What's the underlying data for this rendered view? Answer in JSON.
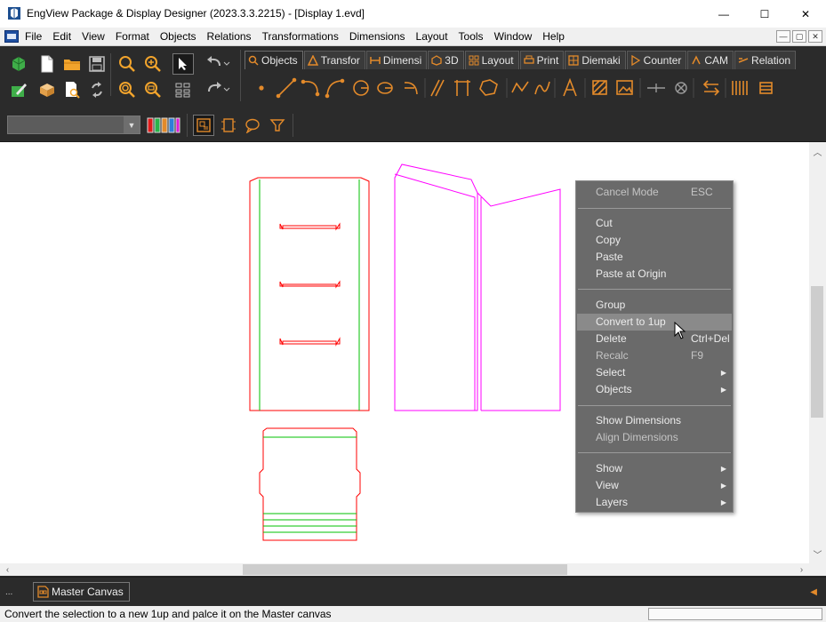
{
  "window": {
    "title": "EngView Package & Display Designer (2023.3.3.2215) - [Display 1.evd]",
    "minimize": "—",
    "maximize": "☐",
    "close": "✕"
  },
  "menu": {
    "items": [
      "File",
      "Edit",
      "View",
      "Format",
      "Objects",
      "Relations",
      "Transformations",
      "Dimensions",
      "Layout",
      "Tools",
      "Window",
      "Help"
    ],
    "mdi_minimize": "—",
    "mdi_restore": "▢",
    "mdi_close": "✕"
  },
  "toolbar": {
    "tabs": [
      {
        "label": "Objects",
        "active": true
      },
      {
        "label": "Transfor",
        "active": false
      },
      {
        "label": "Dimensi",
        "active": false
      },
      {
        "label": "3D",
        "active": false
      },
      {
        "label": "Layout",
        "active": false
      },
      {
        "label": "Print",
        "active": false
      },
      {
        "label": "Diemaki",
        "active": false
      },
      {
        "label": "Counter",
        "active": false
      },
      {
        "label": "CAM",
        "active": false
      },
      {
        "label": "Relation",
        "active": false
      }
    ],
    "layer_combo_value": ""
  },
  "context_menu": {
    "items": [
      {
        "label": "Cancel Mode",
        "shortcut": "ESC",
        "disabled": false
      },
      {
        "label": "Cut",
        "disabled": false
      },
      {
        "label": "Copy",
        "disabled": false
      },
      {
        "label": "Paste",
        "disabled": false
      },
      {
        "label": "Paste at Origin",
        "disabled": false
      },
      {
        "label": "Group",
        "disabled": false
      },
      {
        "label": "Convert to 1up",
        "disabled": false,
        "hover": true
      },
      {
        "label": "Delete",
        "shortcut": "Ctrl+Del",
        "disabled": false
      },
      {
        "label": "Recalc",
        "shortcut": "F9",
        "disabled": true
      },
      {
        "label": "Select",
        "submenu": true,
        "disabled": false
      },
      {
        "label": "Objects",
        "submenu": true,
        "disabled": false
      },
      {
        "label": "Show Dimensions",
        "disabled": false
      },
      {
        "label": "Align Dimensions",
        "disabled": true
      },
      {
        "label": "Show",
        "submenu": true,
        "disabled": false
      },
      {
        "label": "View",
        "submenu": true,
        "disabled": false
      },
      {
        "label": "Layers",
        "submenu": true,
        "disabled": false
      }
    ]
  },
  "canvas_tabs": {
    "more": "...",
    "active_tab": "Master Canvas"
  },
  "status": {
    "text": "Convert the selection to a new 1up and palce it on the Master canvas"
  },
  "colors": {
    "accent": "#e38a2a",
    "cut_line": "#ff0000",
    "crease_line": "#00c000",
    "selected": "#ff00ff",
    "menu_bg": "#6a6a6a"
  }
}
